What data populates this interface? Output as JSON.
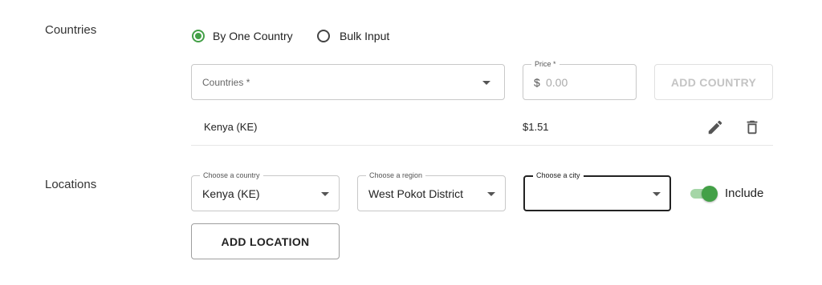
{
  "countries": {
    "section_label": "Countries",
    "mode_options": [
      {
        "label": "By One Country",
        "selected": true
      },
      {
        "label": "Bulk Input",
        "selected": false
      }
    ],
    "country_select": {
      "label": "Countries *",
      "value": ""
    },
    "price": {
      "legend": "Price *",
      "currency_symbol": "$",
      "placeholder": "0.00",
      "value": ""
    },
    "add_button": "ADD COUNTRY",
    "rows": [
      {
        "country": "Kenya (KE)",
        "price": "$1.51",
        "actions": [
          "edit-icon",
          "delete-icon"
        ]
      }
    ]
  },
  "locations": {
    "section_label": "Locations",
    "country_select": {
      "legend": "Choose a country",
      "value": "Kenya (KE)"
    },
    "region_select": {
      "legend": "Choose a region",
      "value": "West Pokot District"
    },
    "city_select": {
      "legend": "Choose a city",
      "value": ""
    },
    "include_toggle": {
      "label": "Include",
      "on": true
    },
    "add_button": "ADD LOCATION"
  },
  "colors": {
    "accent": "#43a047",
    "accent_light": "#a5d6a7"
  }
}
